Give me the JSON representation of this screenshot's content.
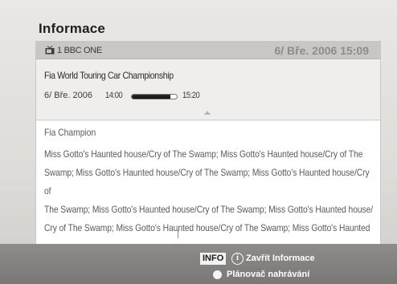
{
  "title": "Informace",
  "channel": {
    "icon": "tv-icon",
    "name": "1 BBC ONE",
    "datetime": "6/ Bře. 2006 15:09"
  },
  "program": {
    "title": "Fia World Touring Car Championship",
    "date": "6/ Bře. 2006",
    "start_time": "14:00",
    "end_time": "15:20",
    "progress_fraction": 0.86
  },
  "description": {
    "heading": "Fia Champion",
    "body": "Miss Gotto's Haunted house/Cry of The Swamp; Miss Gotto's Haunted house/Cry of The\nSwamp; Miss Gotto's Haunted house/Cry of The Swamp; Miss Gotto's Haunted house/Cry of\nThe Swamp; Miss Gotto's Haunted house/Cry of The Swamp; Miss Gotto's Haunted house/\nCry of The Swamp; Miss Gotto's Haunted house/Cry of The Swamp; Miss Gotto's Haunted"
  },
  "footer": {
    "info_key": "INFO",
    "info_icon": "info-circle-icon",
    "close_label": "Zavřít Informace",
    "scheduler_dot_color": "#f4f4f4",
    "scheduler_label": "Plánovač nahrávání"
  }
}
